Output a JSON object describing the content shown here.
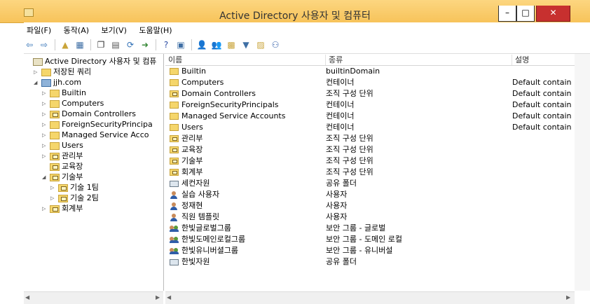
{
  "window": {
    "title": "Active Directory 사용자 및 컴퓨터",
    "minimize": "–",
    "maximize": "□",
    "close": "✕"
  },
  "menu": [
    "파일(F)",
    "동작(A)",
    "보기(V)",
    "도움말(H)"
  ],
  "toolbar": [
    {
      "icon": "back-arrow-icon",
      "glyph": "⇦",
      "color": "#2f6fb5"
    },
    {
      "icon": "forward-arrow-icon",
      "glyph": "⇨",
      "color": "#2f6fb5"
    },
    {
      "sep": true
    },
    {
      "icon": "up-folder-icon",
      "glyph": "▲",
      "color": "#c9a43a"
    },
    {
      "icon": "show-pane-icon",
      "glyph": "▦",
      "color": "#3f6fa5"
    },
    {
      "sep": true
    },
    {
      "icon": "copy-icon",
      "glyph": "❐",
      "color": "#333"
    },
    {
      "icon": "properties-icon",
      "glyph": "▤",
      "color": "#555"
    },
    {
      "icon": "refresh-icon",
      "glyph": "⟳",
      "color": "#2f6fb5"
    },
    {
      "icon": "export-icon",
      "glyph": "➜",
      "color": "#3a8a3a"
    },
    {
      "sep": true
    },
    {
      "icon": "help-icon",
      "glyph": "?",
      "color": "#2f4fa5"
    },
    {
      "icon": "console-icon",
      "glyph": "▣",
      "color": "#3f6fa5"
    },
    {
      "sep": true
    },
    {
      "icon": "new-user-icon",
      "glyph": "👤",
      "color": "#2f5da8"
    },
    {
      "icon": "new-group-icon",
      "glyph": "👥",
      "color": "#2f5da8"
    },
    {
      "icon": "new-ou-icon",
      "glyph": "▩",
      "color": "#c9a43a"
    },
    {
      "icon": "filter-icon",
      "glyph": "▼",
      "color": "#3f6fa5"
    },
    {
      "icon": "add-to-group-icon",
      "glyph": "▨",
      "color": "#c9a43a"
    },
    {
      "icon": "delegate-icon",
      "glyph": "⚇",
      "color": "#2f5da8"
    }
  ],
  "tree": [
    {
      "label": "Active Directory 사용자 및 컴퓨",
      "icon": "ad",
      "twisty": "",
      "indent": 0
    },
    {
      "label": "저장된 쿼리",
      "icon": "folder",
      "twisty": "▷",
      "indent": 1
    },
    {
      "label": "jjh.com",
      "icon": "domain",
      "twisty": "◢",
      "indent": 1
    },
    {
      "label": "Builtin",
      "icon": "folder",
      "twisty": "▷",
      "indent": 2
    },
    {
      "label": "Computers",
      "icon": "folder",
      "twisty": "▷",
      "indent": 2
    },
    {
      "label": "Domain Controllers",
      "icon": "ou",
      "twisty": "▷",
      "indent": 2
    },
    {
      "label": "ForeignSecurityPrincipa",
      "icon": "folder",
      "twisty": "▷",
      "indent": 2
    },
    {
      "label": "Managed Service Acco",
      "icon": "folder",
      "twisty": "▷",
      "indent": 2
    },
    {
      "label": "Users",
      "icon": "folder",
      "twisty": "▷",
      "indent": 2
    },
    {
      "label": "관리부",
      "icon": "ou",
      "twisty": "▷",
      "indent": 2
    },
    {
      "label": "교육장",
      "icon": "ou",
      "twisty": "",
      "indent": 2
    },
    {
      "label": "기술부",
      "icon": "ou",
      "twisty": "◢",
      "indent": 2
    },
    {
      "label": "기술 1팀",
      "icon": "ou",
      "twisty": "▷",
      "indent": 3
    },
    {
      "label": "기술 2팀",
      "icon": "ou",
      "twisty": "▷",
      "indent": 3
    },
    {
      "label": "회계부",
      "icon": "ou",
      "twisty": "▷",
      "indent": 2
    }
  ],
  "columns": {
    "name": "이름",
    "type": "종류",
    "desc": "설명"
  },
  "rows": [
    {
      "name": "Builtin",
      "type": "builtinDomain",
      "desc": "",
      "icon": "folder"
    },
    {
      "name": "Computers",
      "type": "컨테이너",
      "desc": "Default contain",
      "icon": "folder"
    },
    {
      "name": "Domain Controllers",
      "type": "조직 구성 단위",
      "desc": "Default contain",
      "icon": "ou"
    },
    {
      "name": "ForeignSecurityPrincipals",
      "type": "컨테이너",
      "desc": "Default contain",
      "icon": "folder"
    },
    {
      "name": "Managed Service Accounts",
      "type": "컨테이너",
      "desc": "Default contain",
      "icon": "folder"
    },
    {
      "name": "Users",
      "type": "컨테이너",
      "desc": "Default contain",
      "icon": "folder"
    },
    {
      "name": "관리부",
      "type": "조직 구성 단위",
      "desc": "",
      "icon": "ou"
    },
    {
      "name": "교육장",
      "type": "조직 구성 단위",
      "desc": "",
      "icon": "ou"
    },
    {
      "name": "기술부",
      "type": "조직 구성 단위",
      "desc": "",
      "icon": "ou"
    },
    {
      "name": "회계부",
      "type": "조직 구성 단위",
      "desc": "",
      "icon": "ou"
    },
    {
      "name": "세컨자원",
      "type": "공유 폴더",
      "desc": "",
      "icon": "share"
    },
    {
      "name": "실습 사용자",
      "type": "사용자",
      "desc": "",
      "icon": "user"
    },
    {
      "name": "정재현",
      "type": "사용자",
      "desc": "",
      "icon": "user"
    },
    {
      "name": "직원 템플릿",
      "type": "사용자",
      "desc": "",
      "icon": "user"
    },
    {
      "name": "한빛글로벌그룹",
      "type": "보안 그룹 - 글로벌",
      "desc": "",
      "icon": "group"
    },
    {
      "name": "한빛도메인로컬그룹",
      "type": "보안 그룹 - 도메인 로컬",
      "desc": "",
      "icon": "group"
    },
    {
      "name": "한빛유니버셜그룹",
      "type": "보안 그룹 - 유니버설",
      "desc": "",
      "icon": "group"
    },
    {
      "name": "한빛자원",
      "type": "공유 폴더",
      "desc": "",
      "icon": "share"
    }
  ]
}
